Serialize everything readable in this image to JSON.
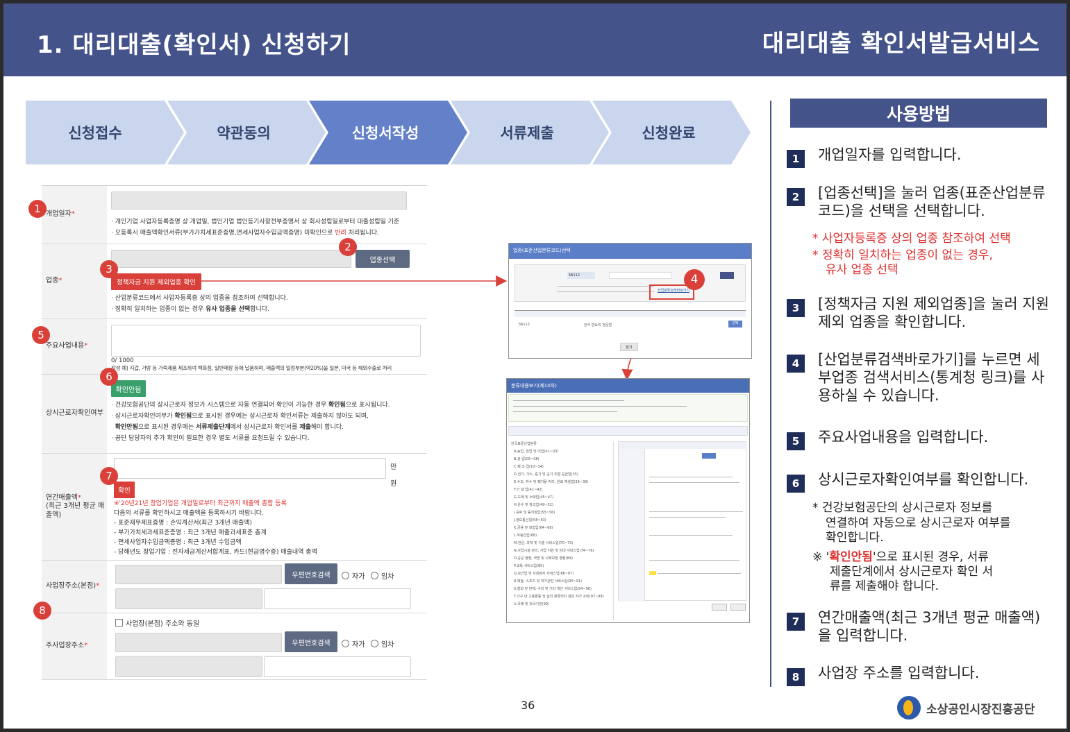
{
  "header": {
    "title_left": "1. 대리대출(확인서) 신청하기",
    "title_right": "대리대출 확인서발급서비스"
  },
  "steps": [
    "신청접수",
    "약관동의",
    "신청서작성",
    "서류제출",
    "신청완료"
  ],
  "active_step": 2,
  "colors": {
    "header": "#44538a",
    "step_inactive": "#c9d6ee",
    "step_active": "#6480c8",
    "red": "#d9403a",
    "badge": "#1f2e58"
  },
  "form": {
    "open_date": {
      "label": "개업일자",
      "notes": [
        "· 개인기업 사업자등록증명 상 개업일, 법인기업 법인등기사항전부증명서 상 회사성립일로부터 대출성립일 기준",
        "· 오등록시 매출액확인서류(부가가치세표준증명,면세사업자수입금액증명) 미확인으로 반려 처리됩니다."
      ]
    },
    "industry": {
      "label": "업종",
      "select_button": "업종선택",
      "excluded_button": "정책자금 지원 제외업종 확인",
      "notes": [
        "· 산업분류코드에서 사업자등록증 상의 업종을 참조하여 선택합니다.",
        "· 정확히 일치하는 업종이 없는 경우 유사 업종을 선택합니다."
      ]
    },
    "main_business": {
      "label": "주요사업내용",
      "counter": "0/ 1000",
      "example": "작성 예) 지갑, 가방 등 가죽제품 제조하여 백화점, 일반매장 등에 납품하며, 매출액의 일정부분(약20%)을 일본, 미국 등 해외수출로 처리"
    },
    "fulltime": {
      "label": "상시근로자확인여부",
      "status_button": "확인안됨",
      "notes": [
        "· 건강보험공단의 상시근로자 정보가 시스템으로 자동 연결되어 확인이 가능한 경우 확인됨으로 표시됩니다.",
        "· 상시근로자확인여부가 확인됨으로 표시된 경우에는 상시근로자 확인서류는 제출하지 않아도 되며,",
        "  확인안됨으로 표시된 경우에는 서류제출단계에서 상시근로자 확인서를 제출해야 합니다.",
        "· 공단 담당자의 추가 확인이 필요한 경우 별도 서류를 요청드릴 수 있습니다."
      ]
    },
    "sales": {
      "label": "연간매출액",
      "label_sub": "(최근 3개년 평균 매출액)",
      "unit_1": "만",
      "unit_2": "원",
      "confirm_button": "확인",
      "red_note": "※'20년21년 창업기업은 개업일로부터 최근까지 매출액 총합 등록",
      "notes": [
        "다음의 서류를 확인하시고 매출액을 등록하시기 바랍니다.",
        "- 표준재무제표증명 : 손익계산서(최근 3개년 매출액)",
        "- 부가가치세과세표준증명 : 최근 3개년 매출과세표준 총계",
        "- 면세사업자수입금액증명 : 최근 3개년 수입금액",
        "- 당해년도 창업기업 : 전자세금계산서합계표, 카드(현금영수증) 매출내역 총액"
      ]
    },
    "hq_address": {
      "label": "사업장주소(본점)",
      "zip_button": "우편번호검색",
      "own": "자가",
      "rent": "임차"
    },
    "main_address": {
      "label": "주사업장주소",
      "same_check": "사업장(본점) 주소와 동일",
      "zip_button": "우편번호검색",
      "own": "자가",
      "rent": "임차"
    }
  },
  "screenshot1": {
    "title": "업종(표준산업분류코드)선택",
    "code_value": "56112",
    "table_code": "56112",
    "table_name": "한식 면요리 전문점",
    "select_btn": "선택",
    "close_btn": "닫기",
    "link_text": "산업분류검색바로가기"
  },
  "screenshot2": {
    "title": "분류내용보기(제10차)",
    "tree": [
      "A.농업, 임업 및 어업(01~03)",
      "B.광 업(05~08)",
      "C.제 조 업(10~34)",
      "D.전기, 가스, 증기 및 공기 조절 공급업(35)",
      "E.수도, 하수 및 폐기물 처리, 원료 재생업(36~39)",
      "F.건 설 업(41~42)",
      "G.도매 및 소매업(45~47)",
      "H.운수 및 창고업(49~52)",
      "I.숙박 및 음식점업(55~56)",
      "J.정보통신업(58~63)",
      "K.금융 및 보험업(64~66)",
      "L.부동산업(68)",
      "M.전문, 과학 및 기술 서비스업(70~73)",
      "N.사업시설 관리, 사업 지원 및 임대 서비스업(74~76)",
      "O.공공 행정, 국방 및 사회보장 행정(84)",
      "P.교육 서비스업(85)",
      "Q.보건업 및 사회복지 서비스업(86~87)",
      "R.예술, 스포츠 및 여가관련 서비스업(90~91)",
      "S.협회 및 단체, 수리 및 기타 개인 서비스업(94~96)",
      "T.가구 내 고용활동 및 달리 분류되지 않은 자가 소비(97~98)",
      "U.국제 및 외국기관(99)"
    ]
  },
  "howto": {
    "title": "사용방법",
    "items": [
      {
        "num": "1",
        "text": "개업일자를 입력합니다."
      },
      {
        "num": "2",
        "text": "[업종선택]을 눌러 업종(표준산업분류코드)을 선택을 선택합니다."
      },
      {
        "num": "3",
        "text": "[정책자금 지원 제외업종]을 눌러 지원제외 업종을 확인합니다."
      },
      {
        "num": "4",
        "text": "[산업분류검색바로가기]를 누르면 세부업종 검색서비스(통계청 링크)를 사용하실 수 있습니다."
      },
      {
        "num": "5",
        "text": "주요사업내용을 입력합니다."
      },
      {
        "num": "6",
        "text": "상시근로자확인여부를 확인합니다."
      },
      {
        "num": "7",
        "text": "연간매출액(최근 3개년 평균 매출액)을 입력합니다."
      },
      {
        "num": "8",
        "text": "사업장 주소를 입력합니다."
      }
    ],
    "note2a": "*  사업자등록증 상의 업종 참조하여 선택",
    "note2b": "*  정확히 일치하는 업종이 없는 경우,",
    "note2c": "유사 업종 선택",
    "note6a": "*  건강보험공단의 상시근로자 정보를",
    "note6b": "연결하여 자동으로 상시근로자 여부를",
    "note6c": "확인합니다.",
    "note6d_pre": "※ '",
    "note6d_red": "확인안됨",
    "note6d_post": "'으로 표시된 경우,  서류",
    "note6e": "제출단계에서 상시근로자 확인 서",
    "note6f": "류를 제출해야 합니다."
  },
  "page_number": "36",
  "org_name": "소상공인시장진흥공단"
}
